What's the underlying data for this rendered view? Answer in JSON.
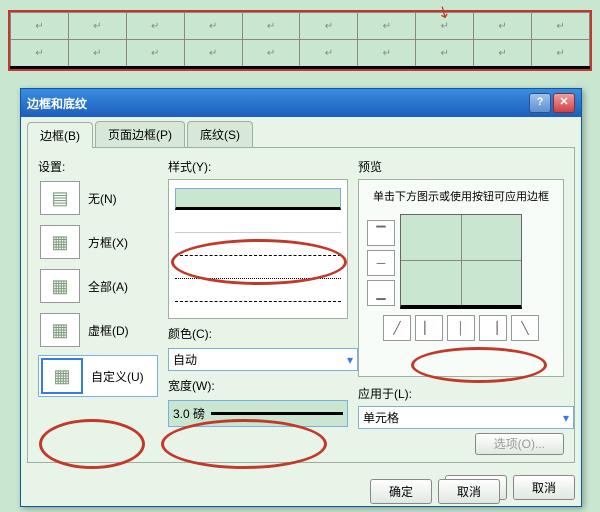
{
  "dialog": {
    "title": "边框和底纹",
    "tabs": [
      "边框(B)",
      "页面边框(P)",
      "底纹(S)"
    ],
    "settings_label": "设置:",
    "settings": [
      {
        "label": "无(N)"
      },
      {
        "label": "方框(X)"
      },
      {
        "label": "全部(A)"
      },
      {
        "label": "虚框(D)"
      },
      {
        "label": "自定义(U)"
      }
    ],
    "style_label": "样式(Y):",
    "color_label": "颜色(C):",
    "color_value": "自动",
    "width_label": "宽度(W):",
    "width_value": "3.0 磅",
    "preview_label": "预览",
    "preview_text": "单击下方图示或使用按钮可应用边框",
    "apply_label": "应用于(L):",
    "apply_value": "单元格",
    "options_btn": "选项(O)...",
    "ok": "确定",
    "cancel": "取消"
  },
  "outer": {
    "ok": "确定",
    "cancel": "取消"
  }
}
